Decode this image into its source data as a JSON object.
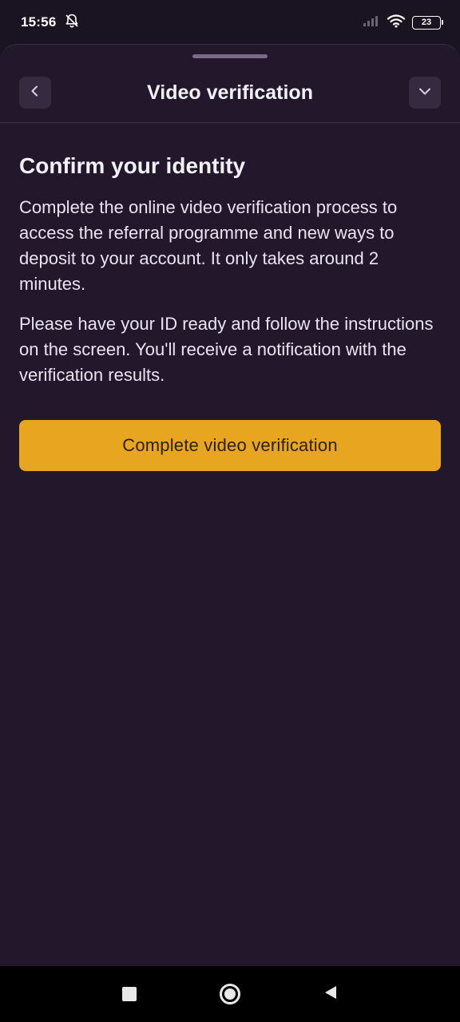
{
  "status_bar": {
    "time": "15:56",
    "battery_level": "23",
    "icons": [
      "bell-off-icon",
      "signal-icon",
      "wifi-icon",
      "battery-icon"
    ]
  },
  "header": {
    "title": "Video verification",
    "back_icon": "chevron-left-icon",
    "collapse_icon": "chevron-down-icon"
  },
  "content": {
    "heading": "Confirm your identity",
    "paragraph_1": "Complete the online video verification process to access the referral programme and new ways to deposit to your account. It only takes around 2 minutes.",
    "paragraph_2": "Please have your ID ready and follow the instructions on the screen. You'll receive a notification with the verification results."
  },
  "cta": {
    "label": "Complete video verification"
  },
  "colors": {
    "accent": "#e8a620",
    "background": "#23182b",
    "button_secondary": "#352a3f"
  },
  "nav_bar": {
    "icons": [
      "recents-square-icon",
      "home-circle-icon",
      "back-triangle-icon"
    ]
  }
}
